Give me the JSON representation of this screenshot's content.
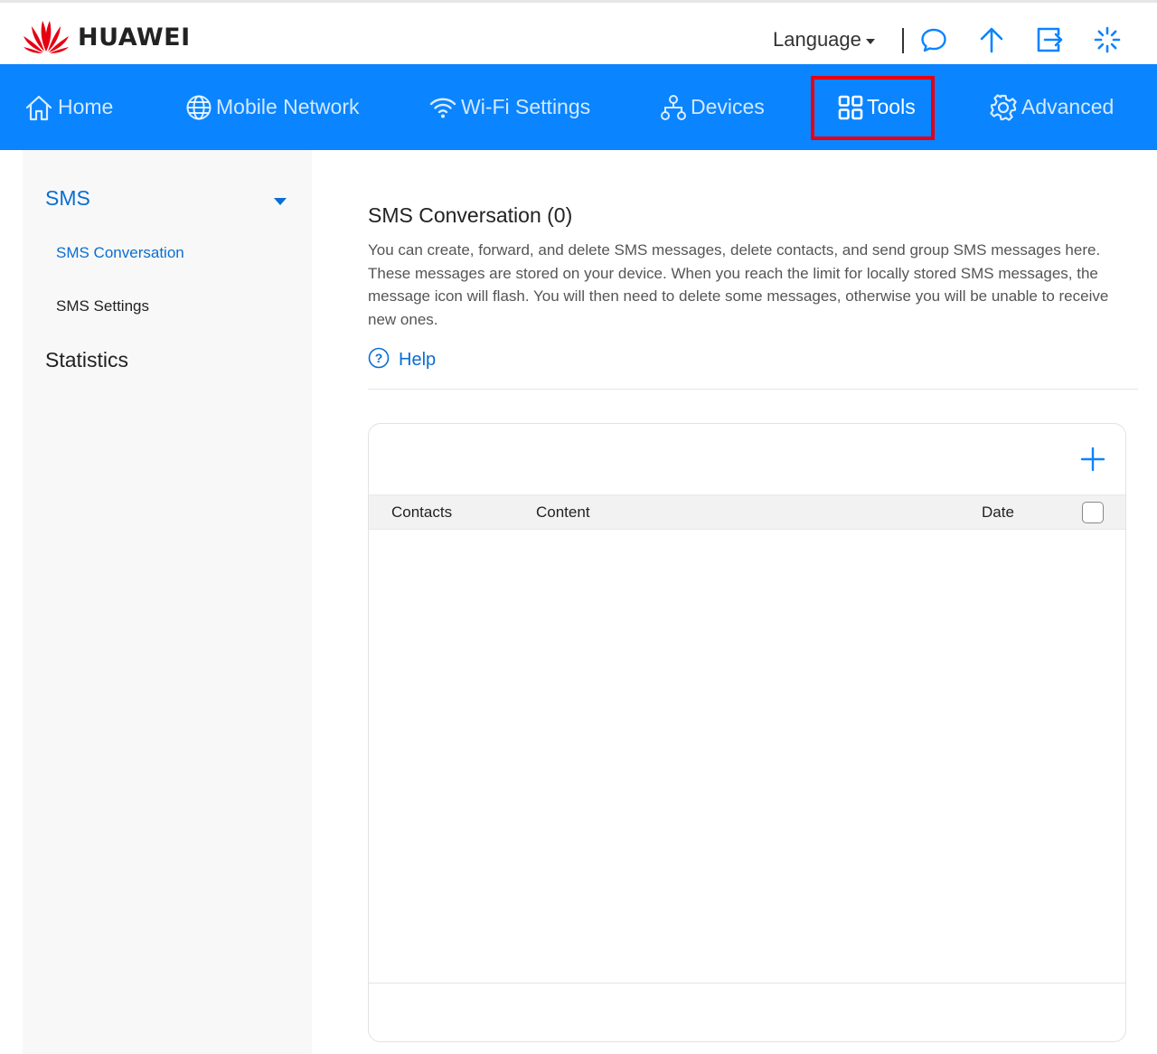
{
  "header": {
    "brand": "HUAWEI",
    "language_label": "Language",
    "icons": [
      "chat-icon",
      "upload-arrow-icon",
      "logout-icon",
      "loading-spinner-icon"
    ]
  },
  "nav": {
    "items": [
      {
        "label": "Home",
        "icon": "home-icon"
      },
      {
        "label": "Mobile Network",
        "icon": "globe-icon"
      },
      {
        "label": "Wi-Fi Settings",
        "icon": "wifi-icon"
      },
      {
        "label": "Devices",
        "icon": "devices-icon"
      },
      {
        "label": "Tools",
        "icon": "grid-icon",
        "active": true
      },
      {
        "label": "Advanced",
        "icon": "gear-icon"
      }
    ]
  },
  "sidebar": {
    "section": "SMS",
    "items": [
      {
        "label": "SMS Conversation",
        "active": true
      },
      {
        "label": "SMS Settings"
      }
    ],
    "section2": "Statistics"
  },
  "main": {
    "title": "SMS Conversation (0)",
    "description": "You can create, forward, and delete SMS messages, delete contacts, and send group SMS messages here. These messages are stored on your device. When you reach the limit for locally stored SMS messages, the message icon will flash. You will then need to delete some messages, otherwise you will be unable to receive new ones.",
    "help_label": "Help",
    "table": {
      "columns": [
        "Contacts",
        "Content",
        "Date"
      ],
      "rows": []
    }
  },
  "colors": {
    "nav_bg": "#0a84ff",
    "accent": "#0a6ed1",
    "highlight_border": "#e50012",
    "logo_red": "#e50012"
  }
}
